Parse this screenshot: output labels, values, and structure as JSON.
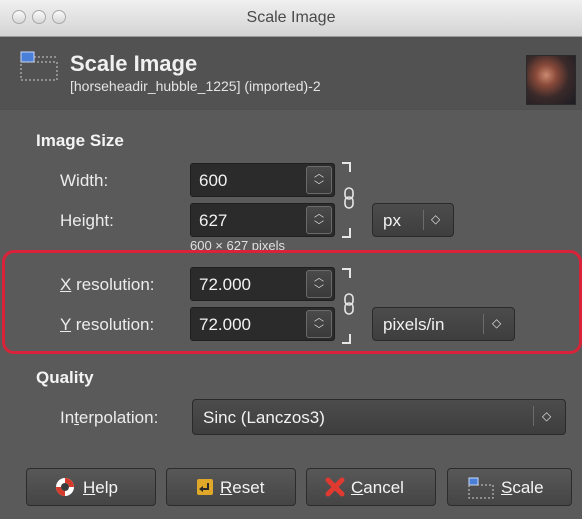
{
  "window": {
    "title": "Scale Image"
  },
  "header": {
    "title": "Scale Image",
    "subtitle": "[horseheadir_hubble_1225] (imported)-2",
    "thumbnail_icon": "image-thumbnail"
  },
  "image_size": {
    "section": "Image Size",
    "width_label": "Width:",
    "width_value": "600",
    "height_label": "Height:",
    "height_value": "627",
    "unit": "px",
    "pixels_hint": "600 × 627 pixels",
    "x_res_label": "X resolution:",
    "x_res_value": "72.000",
    "y_res_label": "Y resolution:",
    "y_res_value": "72.000",
    "res_unit": "pixels/in"
  },
  "quality": {
    "section": "Quality",
    "interpolation_label": "Interpolation:",
    "interpolation_value": "Sinc (Lanczos3)"
  },
  "buttons": {
    "help": "Help",
    "reset": "Reset",
    "cancel": "Cancel",
    "scale": "Scale"
  },
  "colors": {
    "highlight": "#d9233a",
    "background": "#5a5a5a"
  }
}
